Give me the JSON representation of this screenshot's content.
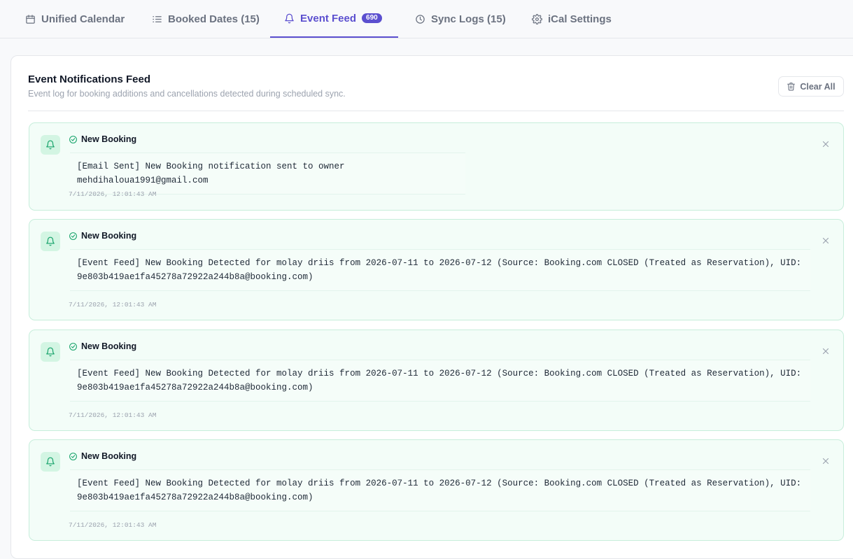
{
  "tabs": [
    {
      "label": "Unified Calendar",
      "icon": "calendar-icon"
    },
    {
      "label": "Booked Dates (15)",
      "icon": "list-icon"
    },
    {
      "label": "Event Feed",
      "icon": "bell-icon",
      "badge": "690",
      "active": true
    },
    {
      "label": "Sync Logs (15)",
      "icon": "clock-icon"
    },
    {
      "label": "iCal Settings",
      "icon": "gear-icon"
    }
  ],
  "panel": {
    "title": "Event Notifications Feed",
    "subtitle": "Event log for booking additions and cancellations detected during scheduled sync.",
    "clear_label": "Clear All"
  },
  "events": [
    {
      "type": "New Booking",
      "lines": [
        "[Email Sent] New Booking notification sent to owner mehdihaloua1991@gmail.com"
      ],
      "time": "7/11/2026, 12:01:43 AM"
    },
    {
      "type": "New Booking",
      "lines": [
        "[Event Feed] New Booking Detected for molay driis from 2026-07-11 to 2026-07-12 (Source: Booking.com CLOSED (Treated as Reservation), UID:",
        "9e803b419ae1fa45278a72922a244b8a@booking.com)"
      ],
      "time": "7/11/2026, 12:01:43 AM"
    },
    {
      "type": "New Booking",
      "lines": [
        "[Event Feed] New Booking Detected for molay driis from 2026-07-11 to 2026-07-12 (Source: Booking.com CLOSED (Treated as Reservation), UID:",
        "9e803b419ae1fa45278a72922a244b8a@booking.com)"
      ],
      "time": "7/11/2026, 12:01:43 AM"
    },
    {
      "type": "New Booking",
      "lines": [
        "[Event Feed] New Booking Detected for molay driis from 2026-07-11 to 2026-07-12 (Source: Booking.com CLOSED (Treated as Reservation), UID:",
        "9e803b419ae1fa45278a72922a244b8a@booking.com)"
      ],
      "time": "7/11/2026, 12:01:43 AM"
    }
  ],
  "colors": {
    "accent": "#5b4fcf",
    "success": "#16a36a",
    "card_bg": "#f3fdf8",
    "card_border": "#c7eedb"
  }
}
